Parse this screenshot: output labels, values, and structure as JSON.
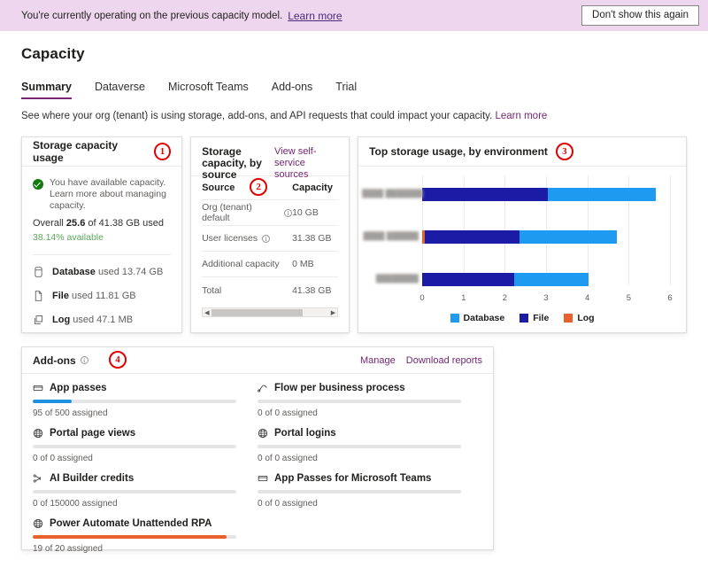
{
  "banner": {
    "text": "You're currently operating on the previous capacity model.",
    "link": "Learn more",
    "dismiss_label": "Don't show this again",
    "bg_color": "#EFD6EF"
  },
  "page": {
    "title": "Capacity",
    "subtitle": "See where your org (tenant) is using storage, add-ons, and API requests that could impact your capacity.",
    "subtitle_link": "Learn more"
  },
  "tabs": [
    {
      "label": "Summary",
      "active": true
    },
    {
      "label": "Dataverse",
      "active": false
    },
    {
      "label": "Microsoft Teams",
      "active": false
    },
    {
      "label": "Add-ons",
      "active": false
    },
    {
      "label": "Trial",
      "active": false
    }
  ],
  "storage_usage": {
    "title": "Storage capacity usage",
    "marker": "1",
    "status_icon": "success-check-icon",
    "message": "You have available capacity. Learn more about managing capacity.",
    "overall_prefix": "Overall ",
    "overall_value": "25.6",
    "overall_suffix": " of 41.38 GB used",
    "available": "38.14% available",
    "available_color": "#5aa85a",
    "items": [
      {
        "icon": "database-icon",
        "name": "Database",
        "value": "used 13.74 GB"
      },
      {
        "icon": "file-icon",
        "name": "File",
        "value": "used 11.81 GB"
      },
      {
        "icon": "log-icon",
        "name": "Log",
        "value": "used 47.1 MB"
      }
    ]
  },
  "by_source": {
    "title": "Storage capacity, by source",
    "link": "View self-service sources",
    "marker": "2",
    "columns": [
      "Source",
      "Capacity"
    ],
    "rows": [
      {
        "source": "Org (tenant) default",
        "info": true,
        "capacity": "10 GB"
      },
      {
        "source": "User licenses",
        "info": true,
        "capacity": "31.38 GB"
      },
      {
        "source": "Additional capacity",
        "info": false,
        "capacity": "0 MB"
      },
      {
        "source": "Total",
        "info": false,
        "capacity": "41.38 GB"
      }
    ],
    "scrollbar": {
      "left_arrow": "◀",
      "right_arrow": "▶"
    }
  },
  "chart_data": {
    "type": "bar",
    "orientation": "horizontal",
    "stacked": true,
    "title": "Top storage usage, by environment",
    "marker": "3",
    "categories": [
      "████ ███████",
      "████ ██████",
      "████████"
    ],
    "series": [
      {
        "name": "Database",
        "color": "#1E9BF0",
        "values": [
          2.6,
          2.36,
          1.81
        ]
      },
      {
        "name": "File",
        "color": "#1B1BA5",
        "values": [
          3.05,
          2.29,
          2.22
        ]
      },
      {
        "name": "Log",
        "color": "#E8612C",
        "values": [
          0.0,
          0.06,
          0.0
        ]
      }
    ],
    "totals": [
      5.65,
      4.71,
      4.03
    ],
    "xlabel": "",
    "ylabel": "",
    "xlim": [
      0,
      6
    ],
    "xticks": [
      "0",
      "1",
      "2",
      "3",
      "4",
      "5",
      "6"
    ],
    "grid": true,
    "legend_position": "bottom",
    "legend": [
      "Database",
      "File",
      "Log"
    ]
  },
  "addons": {
    "title": "Add-ons",
    "info_icon": "info-icon",
    "marker": "4",
    "actions": [
      "Manage",
      "Download reports"
    ],
    "items": [
      {
        "icon": "app-passes-icon",
        "label": "App passes",
        "sub": "95 of 500 assigned",
        "percent": 19,
        "color": "#1E90E0"
      },
      {
        "icon": "flow-icon",
        "label": "Flow per business process",
        "sub": "0 of 0 assigned",
        "percent": 0,
        "color": "#1E90E0"
      },
      {
        "icon": "globe-icon",
        "label": "Portal page views",
        "sub": "0 of 0 assigned",
        "percent": 0,
        "color": "#1E90E0"
      },
      {
        "icon": "globe-icon",
        "label": "Portal logins",
        "sub": "0 of 0 assigned",
        "percent": 0,
        "color": "#1E90E0"
      },
      {
        "icon": "ai-builder-icon",
        "label": "AI Builder credits",
        "sub": "0 of 150000 assigned",
        "percent": 0,
        "color": "#1E90E0"
      },
      {
        "icon": "app-passes-icon",
        "label": "App Passes for Microsoft Teams",
        "sub": "0 of 0 assigned",
        "percent": 0,
        "color": "#1E90E0"
      },
      {
        "icon": "globe-icon",
        "label": "Power Automate Unattended RPA",
        "sub": "19 of 20 assigned",
        "percent": 95,
        "color": "#E8612C"
      }
    ]
  }
}
